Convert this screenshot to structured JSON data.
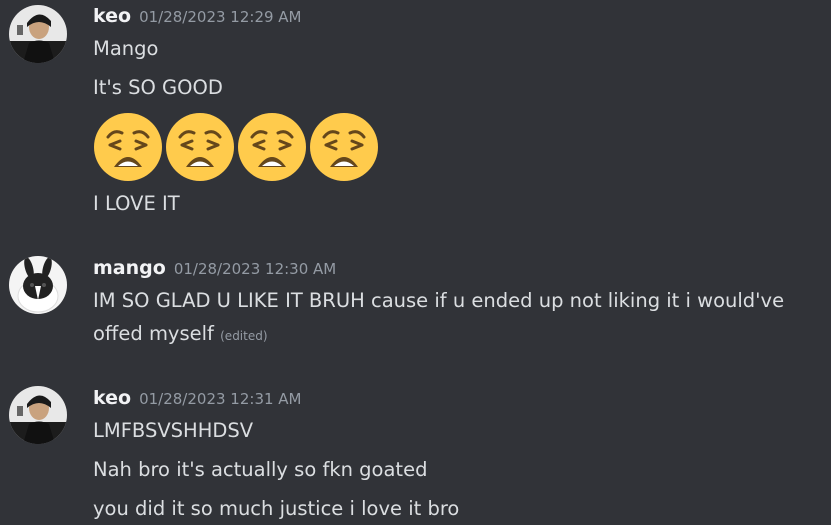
{
  "messages": [
    {
      "author": "keo",
      "timestamp": "01/28/2023 12:29 AM",
      "lines": [
        "Mango",
        "It's SO GOOD",
        "I LOVE IT"
      ],
      "emojis": [
        "weary-face-emoji",
        "weary-face-emoji",
        "weary-face-emoji",
        "weary-face-emoji"
      ]
    },
    {
      "author": "mango",
      "timestamp": "01/28/2023 12:30 AM",
      "lines": [
        "IM SO GLAD U LIKE IT BRUH cause if u ended up not liking it i would've",
        "offed myself"
      ],
      "edited_label": "(edited)"
    },
    {
      "author": "keo",
      "timestamp": "01/28/2023 12:31 AM",
      "lines": [
        "LMFBSVSHHDSV",
        "Nah bro it's actually so fkn goated",
        "you did it so much justice i love it bro"
      ]
    }
  ],
  "colors": {
    "background": "#313338",
    "username": "#f2f3f5",
    "text": "#dbdee1",
    "muted": "#949ba4",
    "emoji_yellow": "#ffcb4c"
  }
}
